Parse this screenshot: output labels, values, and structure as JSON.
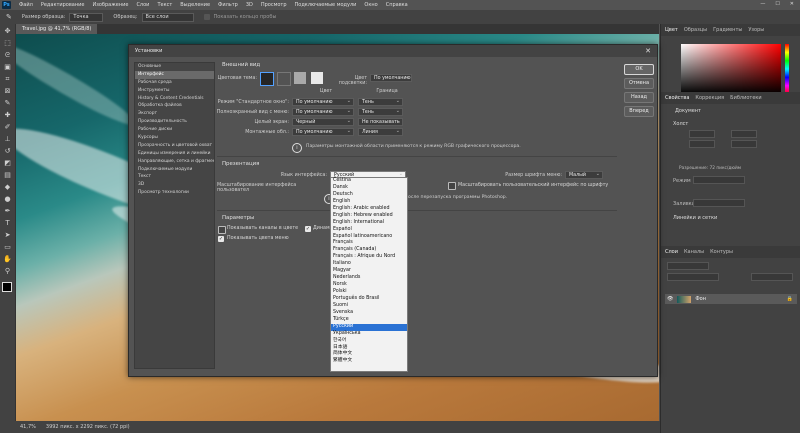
{
  "menubar": {
    "logo": "Ps",
    "items": [
      "Файл",
      "Редактирование",
      "Изображение",
      "Слои",
      "Текст",
      "Выделение",
      "Фильтр",
      "3D",
      "Просмотр",
      "Подключаемые модули",
      "Окно",
      "Справка"
    ],
    "window_controls": [
      "—",
      "☐",
      "✕"
    ]
  },
  "optionsbar": {
    "size_label": "Размер образца:",
    "size_value": "Точка",
    "sample_label": "Образец:",
    "sample_value": "Все слои",
    "ring_label": "Показать кольцо пробы"
  },
  "document": {
    "tab": "Travel.jpg @ 41,7% (RGB/8)"
  },
  "status": {
    "zoom": "41,7%",
    "size": "3992 пикс. x 2292 пикс. (72 ppi)"
  },
  "right_panel": {
    "color_tabs": [
      "Цвет",
      "Образцы",
      "Градиенты",
      "Узоры"
    ],
    "prop_tabs": [
      "Свойства",
      "Коррекция",
      "Библиотеки"
    ],
    "doc_label": "Документ",
    "canvas_header": "Холст",
    "guides_header": "Линейки и сетки",
    "layer_tabs": [
      "Слои",
      "Каналы",
      "Контуры"
    ],
    "layer_name": "Фон",
    "resolution": "Разрешение: 72 пикс/дюйм",
    "mode": "Режим",
    "fill": "Заливка"
  },
  "dialog": {
    "title": "Установки",
    "categories": [
      "Основные",
      "Интерфейс",
      "Рабочая среда",
      "Инструменты",
      "History & Content Credentials",
      "Обработка файлов",
      "Экспорт",
      "Производительность",
      "Рабочие диски",
      "Курсоры",
      "Прозрачность и цветовой охват",
      "Единицы измерения и линейки",
      "Направляющие, сетка и фрагменты",
      "Подключаемые модули",
      "Текст",
      "3D",
      "Просмотр технологии"
    ],
    "buttons": {
      "ok": "OK",
      "cancel": "Отмена",
      "back": "Назад",
      "next": "Вперед"
    },
    "appearance": {
      "header": "Внешний вид",
      "color_theme_label": "Цветовая тема:",
      "highlight_label": "Цвет подсветки:",
      "highlight_value": "По умолчанию",
      "col_color": "Цвет",
      "col_border": "Граница",
      "rows": [
        {
          "label": "Режим \"Стандартное окно\":",
          "color": "По умолчанию",
          "border": "Тень"
        },
        {
          "label": "Полноэкранный вид с меню:",
          "color": "По умолчанию",
          "border": "Тень"
        },
        {
          "label": "Целый экран:",
          "color": "Черный",
          "border": "Не показывать"
        },
        {
          "label": "Монтажные обл.:",
          "color": "По умолчанию",
          "border": "Линия"
        }
      ],
      "info": "Параметры монтажной области применяются к режиму RGB графического процессора.",
      "theme_colors": [
        "#262626",
        "#535353",
        "#a9a9a9",
        "#e8e8e8"
      ]
    },
    "presentation": {
      "header": "Презентация",
      "lang_label": "Язык интерфейса:",
      "lang_value": "Русский",
      "font_size_label": "Размер шрифта меню:",
      "font_size_value": "Малый",
      "scale_label": "Масштабирование интерфейса пользовател",
      "scale_check": "Масштабировать пользовательский интерфейс по шрифту",
      "restart_note": "после перезапуска программы Photoshop."
    },
    "options": {
      "header": "Параметры",
      "channels_color": "Показывать каналы в цвете",
      "dynamic": "Динами",
      "menu_colors": "Показывать цвета меню"
    },
    "languages": [
      "Čeština",
      "Dansk",
      "Deutsch",
      "English",
      "English: Arabic enabled",
      "English: Hebrew enabled",
      "English: International",
      "Español",
      "Español latinoamericano",
      "Français",
      "Français (Canada)",
      "Français : Afrique du Nord",
      "Italiano",
      "Magyar",
      "Nederlands",
      "Norsk",
      "Polski",
      "Português do Brasil",
      "Suomi",
      "Svenska",
      "Türkçe",
      "Русский",
      "Українська",
      "한국어",
      "日本語",
      "简体中文",
      "繁體中文"
    ],
    "selected_language_index": 21
  }
}
